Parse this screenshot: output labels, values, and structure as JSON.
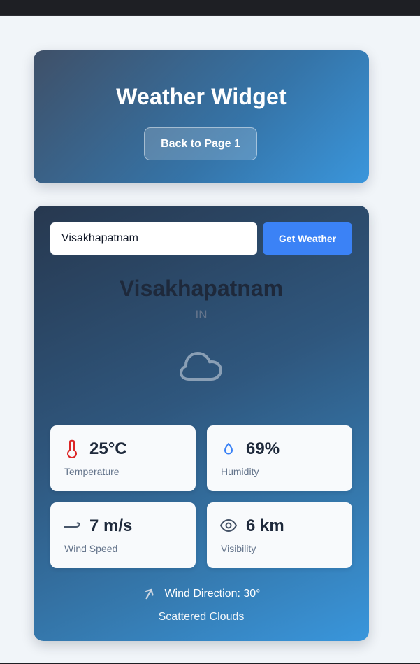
{
  "header": {
    "title": "Weather Widget",
    "back_button_label": "Back to Page 1"
  },
  "search": {
    "value": "Visakhapatnam",
    "button_label": "Get Weather"
  },
  "location": {
    "city": "Visakhapatnam",
    "country": "IN"
  },
  "condition_icon": "cloud-icon",
  "stats": [
    {
      "value": "25°C",
      "label": "Temperature",
      "icon": "thermometer-icon",
      "icon_color": "#dc2626"
    },
    {
      "value": "69%",
      "label": "Humidity",
      "icon": "droplet-icon",
      "icon_color": "#3b82f6"
    },
    {
      "value": "7 m/s",
      "label": "Wind Speed",
      "icon": "wind-icon",
      "icon_color": "#475569"
    },
    {
      "value": "6 km",
      "label": "Visibility",
      "icon": "eye-icon",
      "icon_color": "#475569"
    }
  ],
  "wind_direction": {
    "text": "Wind Direction: 30°",
    "degrees": 30
  },
  "description": "Scattered Clouds",
  "colors": {
    "accent_button": "#3b82f6",
    "card_gradient_start": "#27384f",
    "card_gradient_end": "#3996dc"
  }
}
